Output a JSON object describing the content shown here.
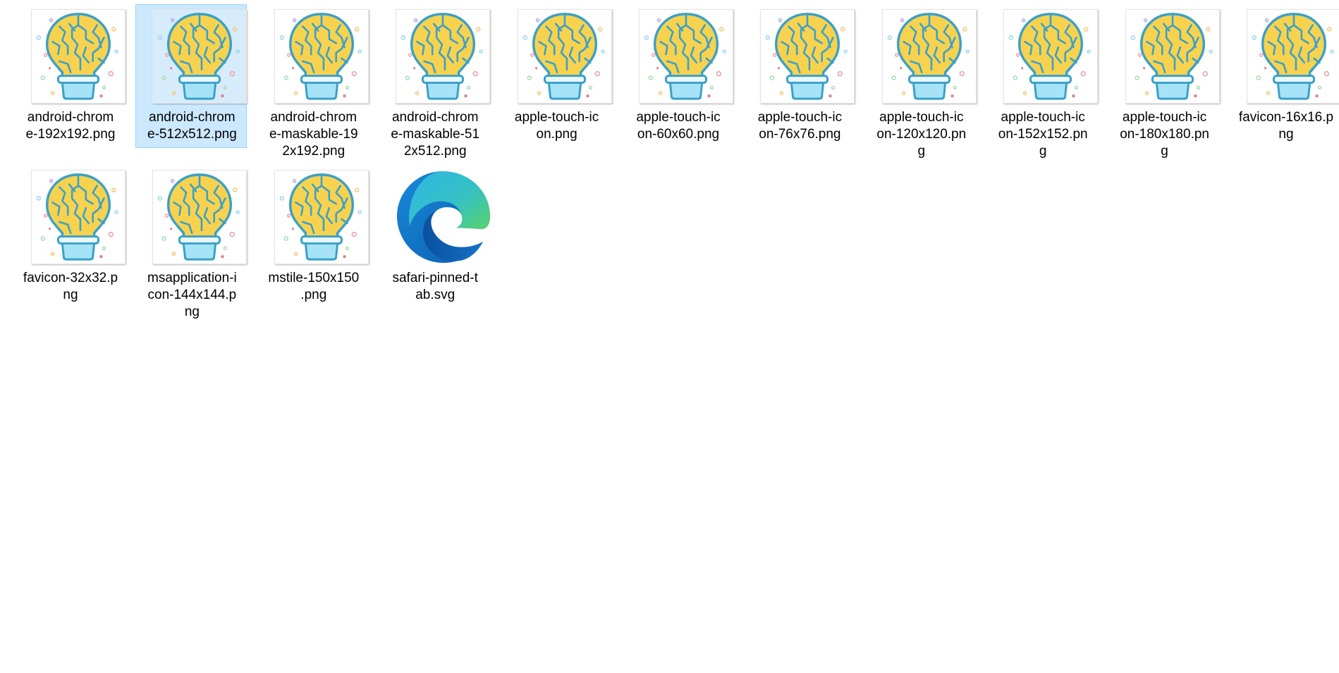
{
  "window": {
    "view_mode": "large-icons"
  },
  "files": [
    {
      "name": "android-chrom\ne-192x192.png",
      "icon": "brain-lightbulb-icon",
      "selected": false
    },
    {
      "name": "android-chrom\ne-512x512.png",
      "icon": "brain-lightbulb-icon",
      "selected": true
    },
    {
      "name": "android-chrom\ne-maskable-19\n2x192.png",
      "icon": "brain-lightbulb-icon",
      "selected": false
    },
    {
      "name": "android-chrom\ne-maskable-51\n2x512.png",
      "icon": "brain-lightbulb-icon",
      "selected": false
    },
    {
      "name": "apple-touch-ic\non.png",
      "icon": "brain-lightbulb-icon",
      "selected": false
    },
    {
      "name": "apple-touch-ic\non-60x60.png",
      "icon": "brain-lightbulb-icon",
      "selected": false
    },
    {
      "name": "apple-touch-ic\non-76x76.png",
      "icon": "brain-lightbulb-icon",
      "selected": false
    },
    {
      "name": "apple-touch-ic\non-120x120.pn\ng",
      "icon": "brain-lightbulb-icon",
      "selected": false
    },
    {
      "name": "apple-touch-ic\non-152x152.pn\ng",
      "icon": "brain-lightbulb-icon",
      "selected": false
    },
    {
      "name": "apple-touch-ic\non-180x180.pn\ng",
      "icon": "brain-lightbulb-icon",
      "selected": false
    },
    {
      "name": "favicon-16x16.p\nng",
      "icon": "brain-lightbulb-icon",
      "selected": false
    },
    {
      "name": "favicon-32x32.p\nng",
      "icon": "brain-lightbulb-icon",
      "selected": false
    },
    {
      "name": "msapplication-i\ncon-144x144.p\nng",
      "icon": "brain-lightbulb-icon",
      "selected": false
    },
    {
      "name": "mstile-150x150\n.png",
      "icon": "brain-lightbulb-icon",
      "selected": false
    },
    {
      "name": "safari-pinned-t\nab.svg",
      "icon": "edge-browser-icon",
      "selected": false
    }
  ],
  "colors": {
    "selection_bg": "#cce8ff",
    "selection_border": "#99d1ff",
    "bulb_fill": "#f7d24f",
    "bulb_stroke": "#3aa0c8",
    "base_fill": "#a6e3f7",
    "edge_blue": "#0b6dc4",
    "edge_green": "#49c86b"
  }
}
